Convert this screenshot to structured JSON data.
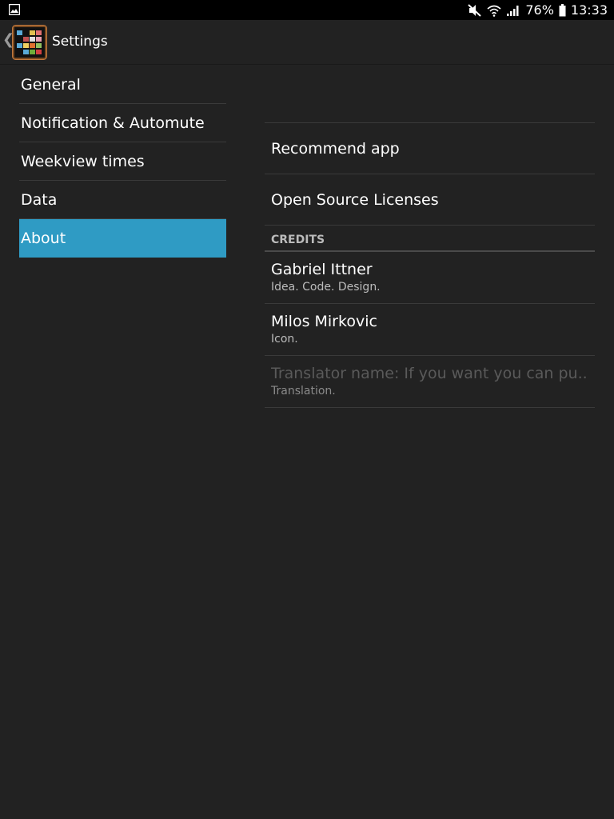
{
  "status_bar": {
    "battery_percent": "76%",
    "time": "13:33",
    "icons": [
      "image-notification-icon",
      "mute-icon",
      "wifi-icon",
      "signal-icon",
      "battery-icon"
    ]
  },
  "action_bar": {
    "title": "Settings",
    "icons": [
      "back-chevron-icon",
      "app-icon"
    ]
  },
  "headers": [
    {
      "label": "General",
      "selected": false
    },
    {
      "label": "Notification & Automute",
      "selected": false
    },
    {
      "label": "Weekview times",
      "selected": false
    },
    {
      "label": "Data",
      "selected": false
    },
    {
      "label": "About",
      "selected": true
    }
  ],
  "about": {
    "items": [
      {
        "title": "Recommend app"
      },
      {
        "title": "Open Source Licenses"
      }
    ],
    "credits_category": "CREDITS",
    "credits": [
      {
        "title": "Gabriel Ittner",
        "summary": "Idea. Code. Design.",
        "enabled": true
      },
      {
        "title": "Milos Mirkovic",
        "summary": "Icon.",
        "enabled": true
      },
      {
        "title": "Translator name: If you want you can pu..",
        "summary": "Translation.",
        "enabled": false
      }
    ]
  },
  "colors": {
    "background": "#222222",
    "selected_header": "#2f9bc4",
    "status_bar": "#000000"
  }
}
